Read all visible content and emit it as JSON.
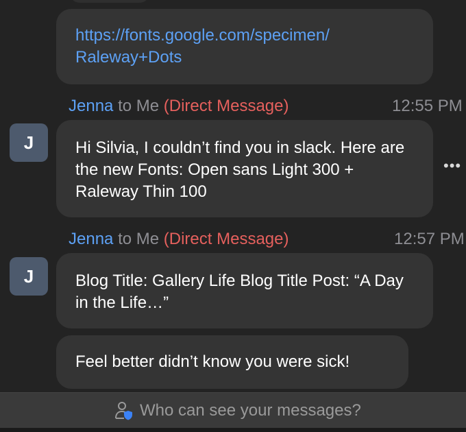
{
  "messages": {
    "link_message": {
      "text": "https://fonts.google.com/specimen/\nRaleway+Dots"
    },
    "msg1": {
      "sender": "Jenna",
      "to": "to Me",
      "tag": "(Direct Message)",
      "time": "12:55 PM",
      "avatar_initial": "J",
      "text": "Hi Silvia, I couldn’t find you in slack. Here are the new Fonts: Open sans Light 300 + Raleway Thin 100"
    },
    "msg2": {
      "sender": "Jenna",
      "to": "to Me",
      "tag": "(Direct Message)",
      "time": "12:57 PM",
      "avatar_initial": "J",
      "text": "Blog Title: Gallery Life Blog Title Post: “A Day in the Life…”"
    },
    "msg3": {
      "text": "Feel better didn’t know you were sick!"
    }
  },
  "more_icon": "ellipsis-icon",
  "footer": {
    "icon": "person-shield-icon",
    "text": "Who can see your messages?"
  },
  "colors": {
    "background": "#232323",
    "bubble": "#343434",
    "sender": "#5da1f5",
    "direct_message": "#e5605d",
    "muted": "#8e8e93",
    "avatar": "#4d5a6d",
    "footer_bg": "#3a3a3a"
  }
}
